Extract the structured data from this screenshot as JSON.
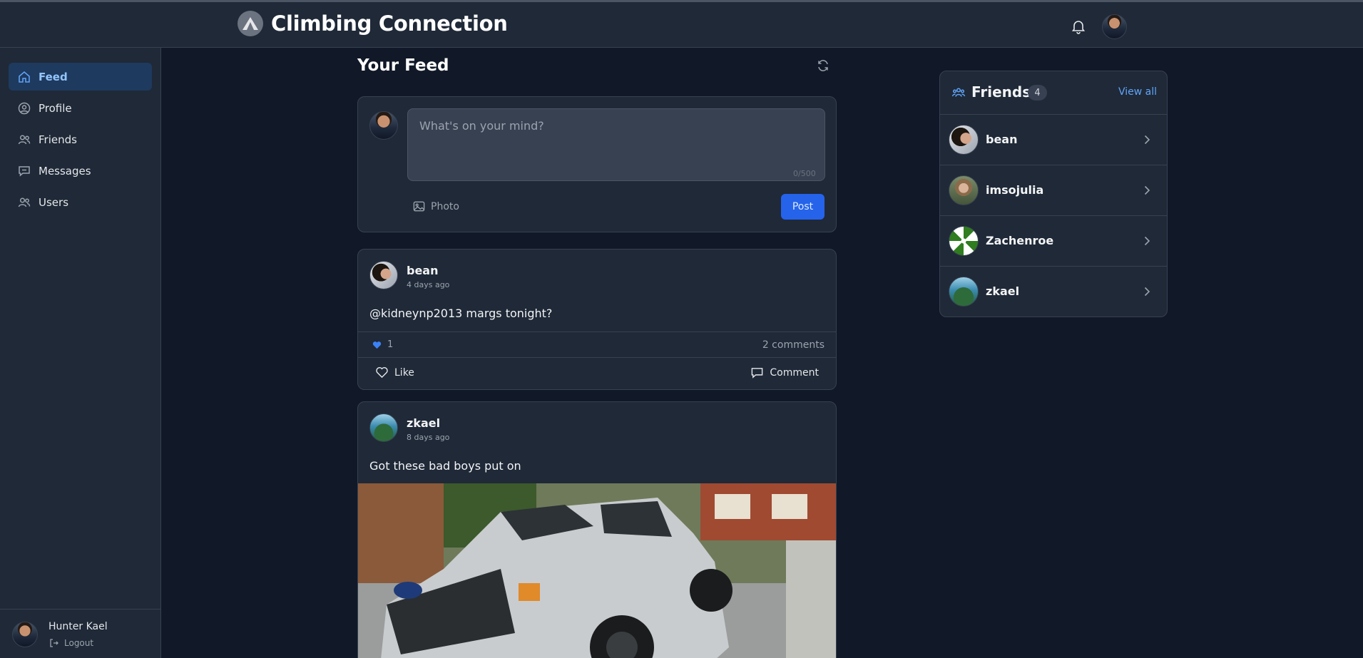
{
  "app": {
    "title": "Climbing Connection"
  },
  "sidebar": {
    "items": [
      {
        "label": "Feed",
        "icon": "home-icon",
        "active": true
      },
      {
        "label": "Profile",
        "icon": "user-circle-icon"
      },
      {
        "label": "Friends",
        "icon": "users-icon"
      },
      {
        "label": "Messages",
        "icon": "chat-icon"
      },
      {
        "label": "Users",
        "icon": "users-icon"
      }
    ],
    "footer": {
      "name": "Hunter Kael",
      "logout": "Logout"
    }
  },
  "feed": {
    "title": "Your Feed",
    "composer": {
      "placeholder": "What's on your mind?",
      "char_count": "0/500",
      "photo_label": "Photo",
      "post_label": "Post"
    },
    "posts": [
      {
        "author": "bean",
        "time": "4 days ago",
        "text": "@kidneynp2013 margs tonight?",
        "likes": "1",
        "comments": "2 comments",
        "like_label": "Like",
        "comment_label": "Comment"
      },
      {
        "author": "zkael",
        "time": "8 days ago",
        "text": "Got these bad boys put on"
      }
    ]
  },
  "friends": {
    "title": "Friends",
    "count": "4",
    "view_all": "View all",
    "list": [
      {
        "name": "bean"
      },
      {
        "name": "imsojulia"
      },
      {
        "name": "Zachenroe"
      },
      {
        "name": "zkael"
      }
    ]
  },
  "colors": {
    "background": "#111827",
    "surface": "#1f2937",
    "accent": "#2563eb",
    "link": "#60a5fa",
    "active_nav": "#1e3a5f"
  }
}
